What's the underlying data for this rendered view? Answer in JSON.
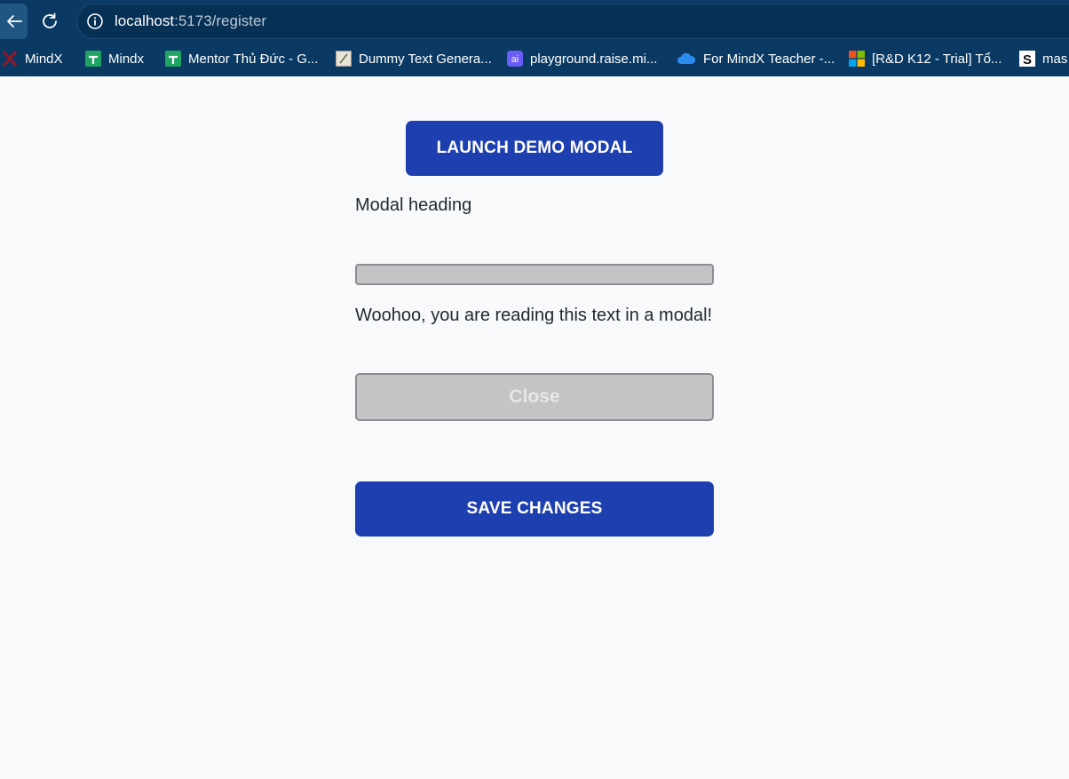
{
  "browser": {
    "url_host": "localhost",
    "url_path": ":5173/register",
    "bookmarks": [
      {
        "label": "MindX",
        "icon": "mindx-x-icon"
      },
      {
        "label": "Mindx",
        "icon": "google-sheets-icon"
      },
      {
        "label": "Mentor Thủ Đức - G...",
        "icon": "google-sheets-icon"
      },
      {
        "label": "Dummy Text Genera...",
        "icon": "dummy-text-icon"
      },
      {
        "label": "playground.raise.mi...",
        "icon": "ai-icon"
      },
      {
        "label": "For MindX Teacher -...",
        "icon": "onedrive-cloud-icon"
      },
      {
        "label": "[R&D K12 - Trial] Tổ...",
        "icon": "microsoft-icon"
      },
      {
        "label": "mas",
        "icon": "s-letter-icon"
      }
    ]
  },
  "page": {
    "launch_label": "LAUNCH DEMO MODAL",
    "modal_heading": "Modal heading",
    "modal_body": "Woohoo, you are reading this text in a modal!",
    "close_label": "Close",
    "save_label": "SAVE CHANGES"
  },
  "colors": {
    "chrome_bg": "#0a3a63",
    "primary": "#1e3faf",
    "disabled_bg": "#c3c4c6",
    "page_bg": "#f8f9fb"
  }
}
